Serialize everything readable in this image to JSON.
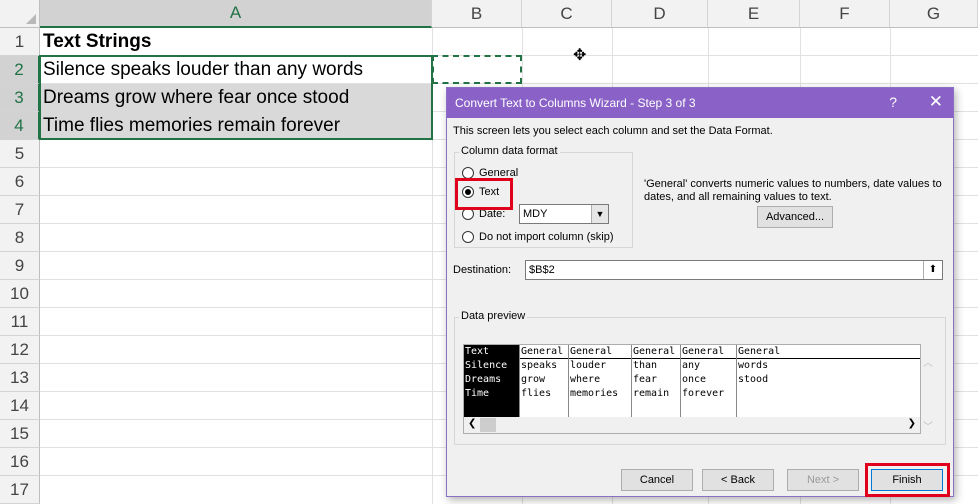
{
  "sheet": {
    "columns": [
      "A",
      "B",
      "C",
      "D",
      "E",
      "F",
      "G"
    ],
    "rows": [
      "1",
      "2",
      "3",
      "4",
      "5",
      "6",
      "7",
      "8",
      "9",
      "10",
      "11",
      "12",
      "13",
      "14",
      "15",
      "16",
      "17"
    ],
    "cells": {
      "a1": "Text Strings",
      "a2": "Silence speaks louder than any words",
      "a3": "Dreams grow where fear once stood",
      "a4": "Time flies memories remain forever"
    },
    "accent_color": "#217346"
  },
  "dialog": {
    "title": "Convert Text to Columns Wizard - Step 3 of 3",
    "help": "?",
    "close": "✕",
    "description": "This screen lets you select each column and set the Data Format.",
    "column_format": {
      "legend": "Column data format",
      "general": "General",
      "text": "Text",
      "date": "Date:",
      "date_value": "MDY",
      "skip": "Do not import column (skip)",
      "selected": "text"
    },
    "general_note": "'General' converts numeric values to numbers, date values to dates, and all remaining values to text.",
    "advanced_label": "Advanced...",
    "destination_label": "Destination:",
    "destination_value": "$B$2",
    "preview": {
      "legend": "Data preview",
      "columns": [
        {
          "header": "Text",
          "cells": [
            "Silence",
            "Dreams",
            "Time"
          ]
        },
        {
          "header": "General",
          "cells": [
            "speaks",
            "grow",
            "flies"
          ]
        },
        {
          "header": "General",
          "cells": [
            "louder",
            "where",
            "memories"
          ]
        },
        {
          "header": "General",
          "cells": [
            "than",
            "fear",
            "remain"
          ]
        },
        {
          "header": "General",
          "cells": [
            "any",
            "once",
            "forever"
          ]
        },
        {
          "header": "General",
          "cells": [
            "words",
            "stood",
            ""
          ]
        }
      ]
    },
    "buttons": {
      "cancel": "Cancel",
      "back": "< Back",
      "next": "Next >",
      "finish": "Finish"
    },
    "title_color": "#8a62c7",
    "highlight_color": "#e0001b"
  }
}
